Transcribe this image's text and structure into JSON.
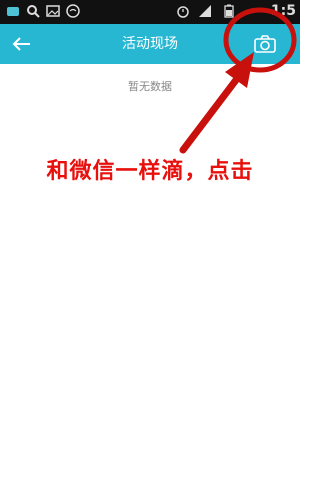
{
  "status_bar": {
    "time": "1:5",
    "icons": [
      "notification-icon",
      "search-icon",
      "image-icon",
      "wifi-icon",
      "alarm-icon",
      "signal-icon",
      "battery-icon"
    ]
  },
  "nav_bar": {
    "title": "活动现场",
    "back_icon": "back-arrow-icon",
    "action_icon": "camera-icon",
    "background_color": "#27b7d2"
  },
  "main": {
    "empty_text": "暂无数据"
  },
  "annotation": {
    "text": "和微信一样滴，点击",
    "color": "#e8100c"
  }
}
